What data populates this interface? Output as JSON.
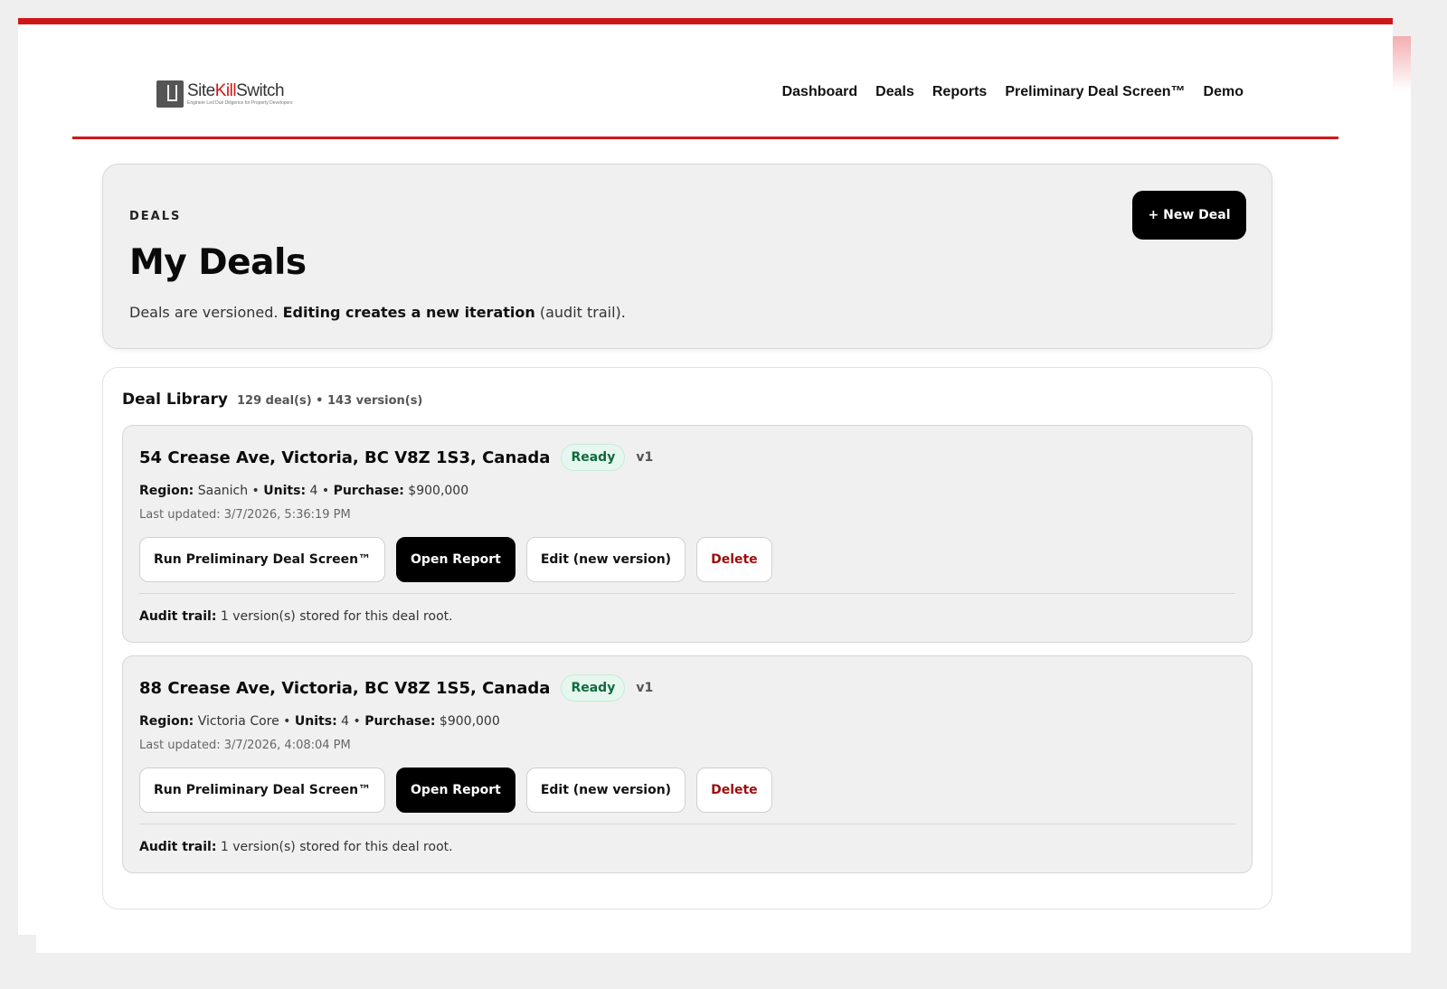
{
  "header": {
    "logo": {
      "name_part1": "Site",
      "name_part2": "Kill",
      "name_part3": "Switch",
      "tagline": "Engineer Led Due Diligence for Property Developers"
    },
    "nav": [
      "Dashboard",
      "Deals",
      "Reports",
      "Preliminary Deal Screen™",
      "Demo"
    ]
  },
  "hero": {
    "eyebrow": "DEALS",
    "title": "My Deals",
    "desc_start": "Deals are versioned. ",
    "desc_bold": "Editing creates a new iteration",
    "desc_end": " (audit trail).",
    "new_deal_label": "+ New Deal"
  },
  "library": {
    "title": "Deal Library",
    "count": "129 deal(s) • 143 version(s)"
  },
  "labels": {
    "region": "Region:",
    "units": "Units:",
    "purchase": "Purchase:",
    "sep": " • ",
    "audit": "Audit trail:",
    "run": "Run Preliminary Deal Screen™",
    "open": "Open Report",
    "edit": "Edit (new version)",
    "delete": "Delete"
  },
  "deals": [
    {
      "address": "54 Crease Ave, Victoria, BC V8Z 1S3, Canada",
      "status": "Ready",
      "version": "v1",
      "region": " Saanich",
      "units": " 4",
      "purchase": " $900,000",
      "updated": "Last updated: 3/7/2026, 5:36:19 PM",
      "audit": " 1 version(s) stored for this deal root."
    },
    {
      "address": "88 Crease Ave, Victoria, BC V8Z 1S5, Canada",
      "status": "Ready",
      "version": "v1",
      "region": " Victoria Core",
      "units": " 4",
      "purchase": " $900,000",
      "updated": "Last updated: 3/7/2026, 4:08:04 PM",
      "audit": " 1 version(s) stored for this deal root."
    }
  ],
  "colors": {
    "accent": "#d01717",
    "ready_text": "#0e6b3c",
    "danger": "#9b0d0d"
  }
}
